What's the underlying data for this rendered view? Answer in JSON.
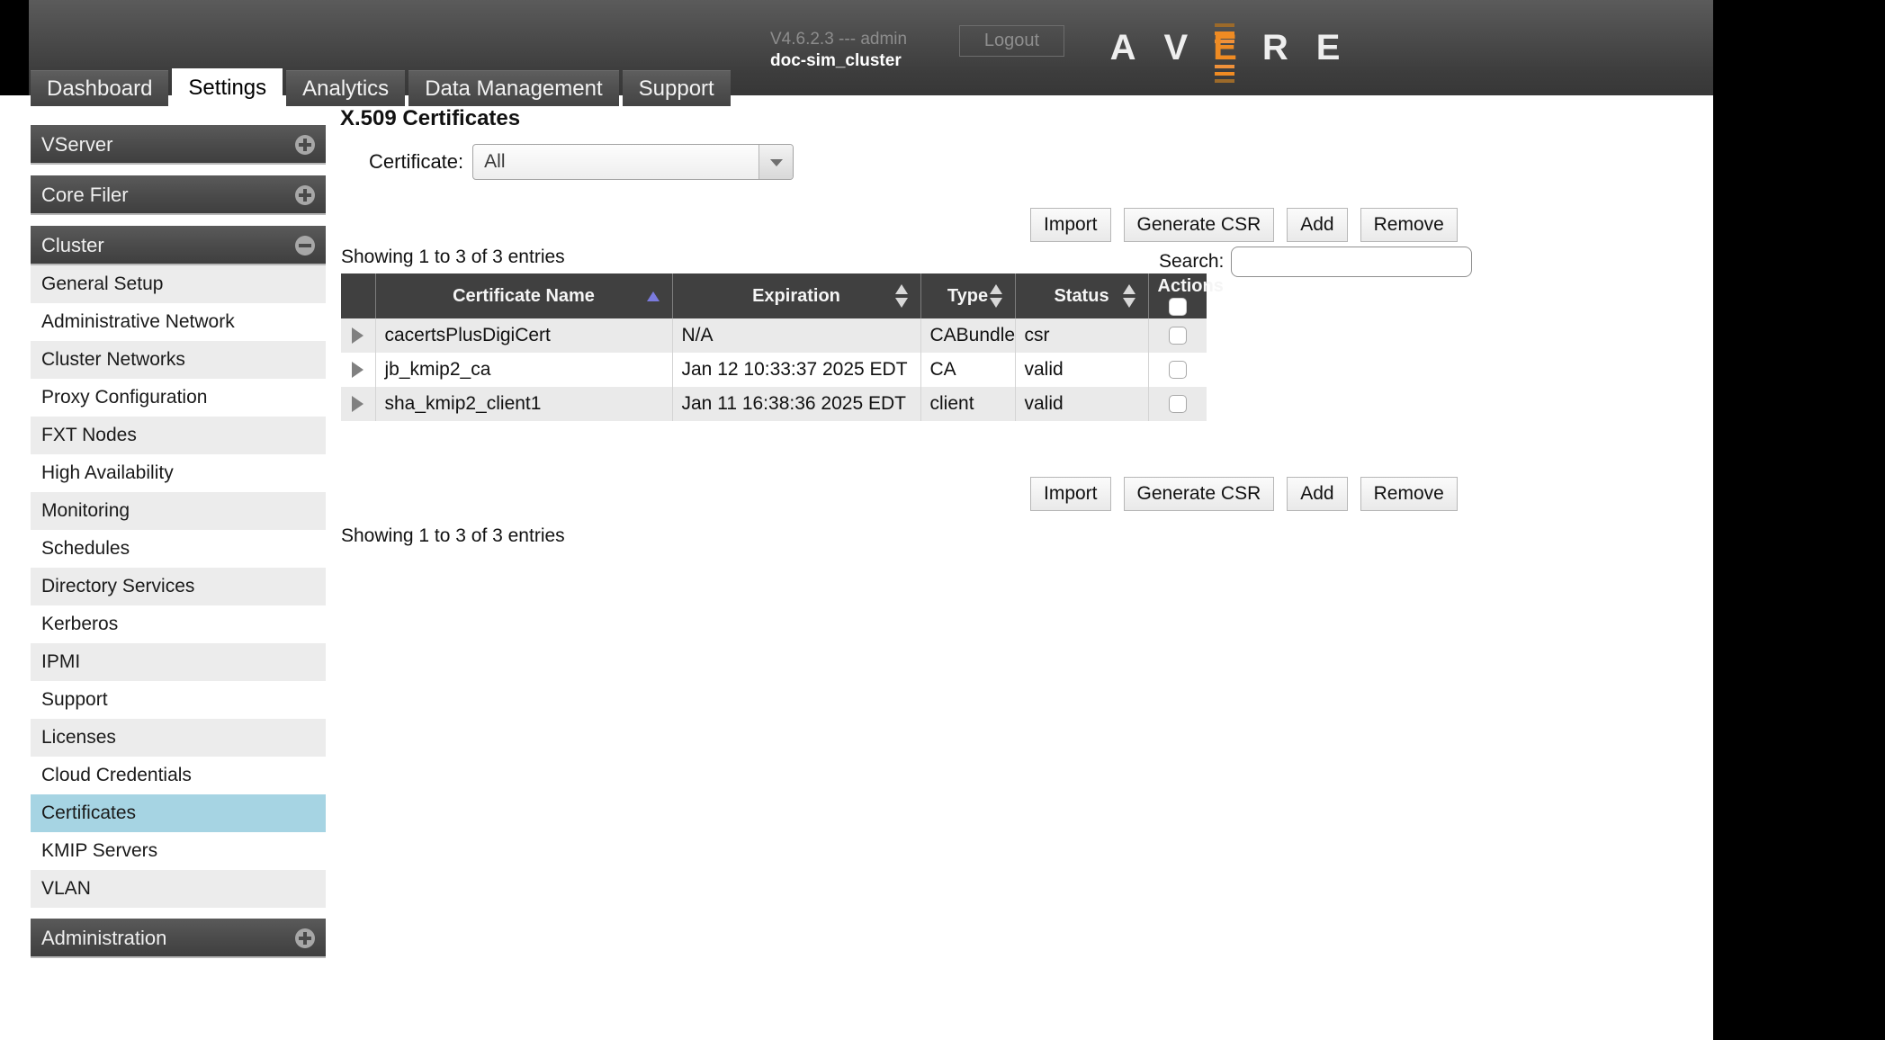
{
  "header": {
    "logout_label": "Logout",
    "brand_letters": [
      "A",
      "V",
      "E",
      "R",
      "E"
    ],
    "brand_accent_index": 2,
    "accent_color": "#ef8b23",
    "version_line": "V4.6.2.3 --- admin",
    "cluster_name": "doc-sim_cluster"
  },
  "tabs": [
    {
      "label": "Dashboard",
      "active": false
    },
    {
      "label": "Settings",
      "active": true
    },
    {
      "label": "Analytics",
      "active": false
    },
    {
      "label": "Data Management",
      "active": false
    },
    {
      "label": "Support",
      "active": false
    }
  ],
  "sidebar": {
    "groups": [
      {
        "label": "VServer",
        "state": "collapsed",
        "icon": "plus-icon",
        "items": []
      },
      {
        "label": "Core Filer",
        "state": "collapsed",
        "icon": "plus-icon",
        "items": []
      },
      {
        "label": "Cluster",
        "state": "expanded",
        "icon": "minus-icon",
        "items": [
          {
            "label": "General Setup",
            "active": false
          },
          {
            "label": "Administrative Network",
            "active": false
          },
          {
            "label": "Cluster Networks",
            "active": false
          },
          {
            "label": "Proxy Configuration",
            "active": false
          },
          {
            "label": "FXT Nodes",
            "active": false
          },
          {
            "label": "High Availability",
            "active": false
          },
          {
            "label": "Monitoring",
            "active": false
          },
          {
            "label": "Schedules",
            "active": false
          },
          {
            "label": "Directory Services",
            "active": false
          },
          {
            "label": "Kerberos",
            "active": false
          },
          {
            "label": "IPMI",
            "active": false
          },
          {
            "label": "Support",
            "active": false
          },
          {
            "label": "Licenses",
            "active": false
          },
          {
            "label": "Cloud Credentials",
            "active": false
          },
          {
            "label": "Certificates",
            "active": true
          },
          {
            "label": "KMIP Servers",
            "active": false
          },
          {
            "label": "VLAN",
            "active": false
          }
        ]
      },
      {
        "label": "Administration",
        "state": "collapsed",
        "icon": "plus-icon",
        "items": []
      }
    ],
    "active_color": "#a6d4e3"
  },
  "main": {
    "page_title": "X.509 Certificates",
    "filter": {
      "label": "Certificate:",
      "selected": "All",
      "options": [
        "All"
      ]
    },
    "actions": [
      {
        "label": "Import"
      },
      {
        "label": "Generate CSR"
      },
      {
        "label": "Add"
      },
      {
        "label": "Remove"
      }
    ],
    "showing_top": "Showing 1 to 3 of 3 entries",
    "showing_bottom": "Showing 1 to 3 of 3 entries",
    "search": {
      "label": "Search:",
      "value": "",
      "placeholder": ""
    },
    "table": {
      "columns": [
        {
          "key": "expand",
          "label": "",
          "sort": "none"
        },
        {
          "key": "name",
          "label": "Certificate Name",
          "sort": "asc"
        },
        {
          "key": "exp",
          "label": "Expiration",
          "sort": "both"
        },
        {
          "key": "type",
          "label": "Type",
          "sort": "both"
        },
        {
          "key": "status",
          "label": "Status",
          "sort": "both"
        },
        {
          "key": "actions",
          "label": "Actions",
          "sort": "none"
        }
      ],
      "rows": [
        {
          "name": "cacertsPlusDigiCert",
          "expiration": "N/A",
          "type": "CABundle",
          "status": "csr",
          "checked": false
        },
        {
          "name": "jb_kmip2_ca",
          "expiration": "Jan 12 10:33:37 2025 EDT",
          "type": "CA",
          "status": "valid",
          "checked": false
        },
        {
          "name": "sha_kmip2_client1",
          "expiration": "Jan 11 16:38:36 2025 EDT",
          "type": "client",
          "status": "valid",
          "checked": false
        }
      ]
    }
  }
}
